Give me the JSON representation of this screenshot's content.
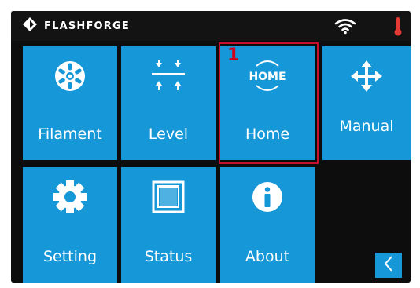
{
  "topbar": {
    "brand": "FLASHFORGE",
    "icons": [
      "flashforge-logo-icon",
      "wifi-icon",
      "thermometer-icon"
    ]
  },
  "tiles": {
    "filament": {
      "label": "Filament",
      "icon": "filament-spool-icon"
    },
    "level": {
      "label": "Level",
      "icon": "level-arrows-icon"
    },
    "home": {
      "label": "Home",
      "icon_text": "HOME",
      "icon": "home-icon"
    },
    "manual": {
      "label": "Manual",
      "icon": "move-arrows-icon"
    },
    "setting": {
      "label": "Setting",
      "icon": "gear-icon"
    },
    "status": {
      "label": "Status",
      "icon": "printer-icon"
    },
    "about": {
      "label": "About",
      "icon": "info-icon"
    }
  },
  "back_button": {
    "icon": "chevron-left-icon"
  },
  "annotation": {
    "number": "1",
    "target": "home"
  },
  "colors": {
    "tile": "#1597d8",
    "background": "#0d0d0d",
    "highlight": "#c8102e",
    "thermometer": "#e53935"
  }
}
